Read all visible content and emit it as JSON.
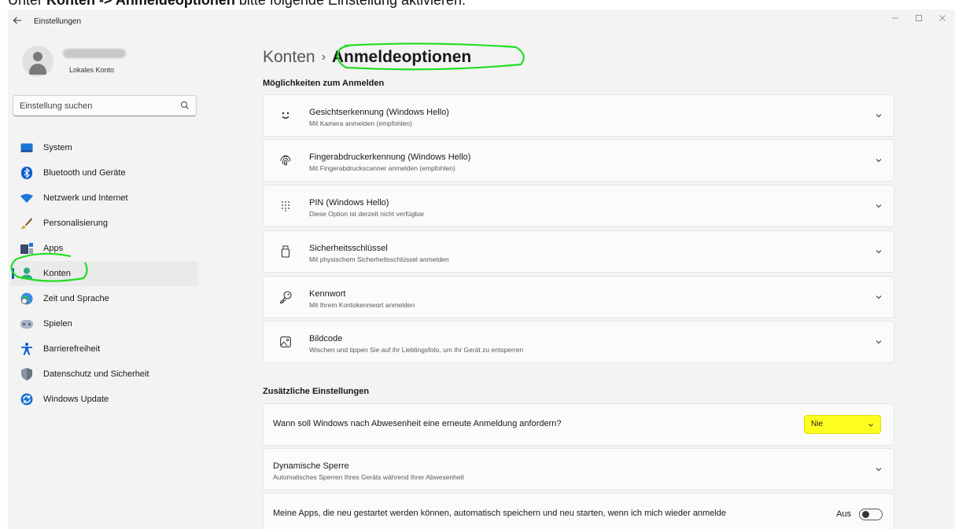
{
  "caption": {
    "prefix": "Unter ",
    "bold": "Konten -> Anmeldeoptionen",
    "suffix": " bitte folgende Einstellung aktivieren:"
  },
  "window": {
    "title": "Einstellungen",
    "back_icon": "arrow-left-icon",
    "controls": [
      "minimize-icon",
      "maximize-icon",
      "close-icon"
    ]
  },
  "profile": {
    "account_type": "Lokales Konto"
  },
  "search": {
    "placeholder": "Einstellung suchen"
  },
  "nav": {
    "items": [
      {
        "label": "System",
        "icon": "monitor-icon"
      },
      {
        "label": "Bluetooth und Geräte",
        "icon": "bluetooth-icon"
      },
      {
        "label": "Netzwerk und Internet",
        "icon": "wifi-icon"
      },
      {
        "label": "Personalisierung",
        "icon": "brush-icon"
      },
      {
        "label": "Apps",
        "icon": "apps-icon"
      },
      {
        "label": "Konten",
        "icon": "account-icon",
        "active": true
      },
      {
        "label": "Zeit und Sprache",
        "icon": "globe-clock-icon"
      },
      {
        "label": "Spielen",
        "icon": "gamepad-icon"
      },
      {
        "label": "Barrierefreiheit",
        "icon": "accessibility-icon"
      },
      {
        "label": "Datenschutz und Sicherheit",
        "icon": "shield-icon"
      },
      {
        "label": "Windows Update",
        "icon": "windows-update-icon"
      }
    ]
  },
  "breadcrumb": {
    "parent": "Konten",
    "separator": "›",
    "current": "Anmeldeoptionen"
  },
  "sections": {
    "signin_title": "Möglichkeiten zum Anmelden",
    "additional_title": "Zusätzliche Einstellungen"
  },
  "signin_options": [
    {
      "title": "Gesichtserkennung (Windows Hello)",
      "subtitle": "Mit Kamera anmelden (empfohlen)",
      "icon": "face-icon"
    },
    {
      "title": "Fingerabdruckerkennung (Windows Hello)",
      "subtitle": "Mit Fingerabdruckscanner anmelden (empfohlen)",
      "icon": "fingerprint-icon"
    },
    {
      "title": "PIN (Windows Hello)",
      "subtitle": "Diese Option ist derzeit nicht verfügbar",
      "icon": "pin-keypad-icon"
    },
    {
      "title": "Sicherheitsschlüssel",
      "subtitle": "Mit physischem Sicherheitsschlüssel anmelden",
      "icon": "usb-key-icon"
    },
    {
      "title": "Kennwort",
      "subtitle": "Mit Ihrem Kontokennwort anmelden",
      "icon": "key-icon"
    },
    {
      "title": "Bildcode",
      "subtitle": "Wischen und tippen Sie auf ihr Lieblingsfoto, um Ihr Gerät zu entsperren",
      "icon": "picture-icon"
    }
  ],
  "additional": {
    "require_signin": {
      "label": "Wann soll Windows nach Abwesenheit eine erneute Anmeldung anfordern?",
      "value": "Nie"
    },
    "dynamic_lock": {
      "title": "Dynamische Sperre",
      "subtitle": "Automatisches Sperren Ihres Geräts während Ihrer Abwesenheit"
    },
    "restart_apps": {
      "label": "Meine Apps, die neu gestartet werden können, automatisch speichern und neu starten, wenn ich mich wieder anmelde",
      "state": "Aus"
    }
  },
  "colors": {
    "accent": "#005fb8",
    "highlight_green": "#22dd22",
    "highlight_yellow": "#fdfd20"
  }
}
